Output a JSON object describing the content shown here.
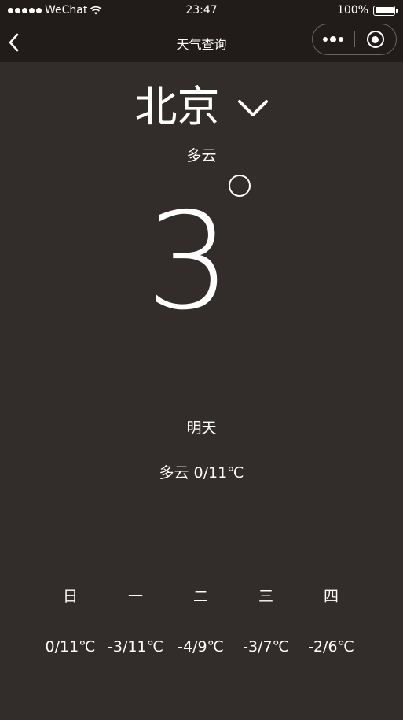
{
  "status_bar": {
    "carrier": "WeChat",
    "time": "23:47",
    "battery": "100%",
    "battery_level": 1.0,
    "signal_bars": 5
  },
  "nav": {
    "title": "天气查询"
  },
  "weather": {
    "city": "北京",
    "condition": "多云",
    "temperature": "3"
  },
  "tomorrow": {
    "label": "明天",
    "summary": "多云 0/11℃"
  },
  "forecast": [
    {
      "day": "日",
      "range": "0/11℃"
    },
    {
      "day": "一",
      "range": "-3/11℃"
    },
    {
      "day": "二",
      "range": "-4/9℃"
    },
    {
      "day": "三",
      "range": "-3/7℃"
    },
    {
      "day": "四",
      "range": "-2/6℃"
    }
  ],
  "colors": {
    "background": "#322c2a",
    "header": "#211c1a",
    "text": "#ffffff"
  }
}
